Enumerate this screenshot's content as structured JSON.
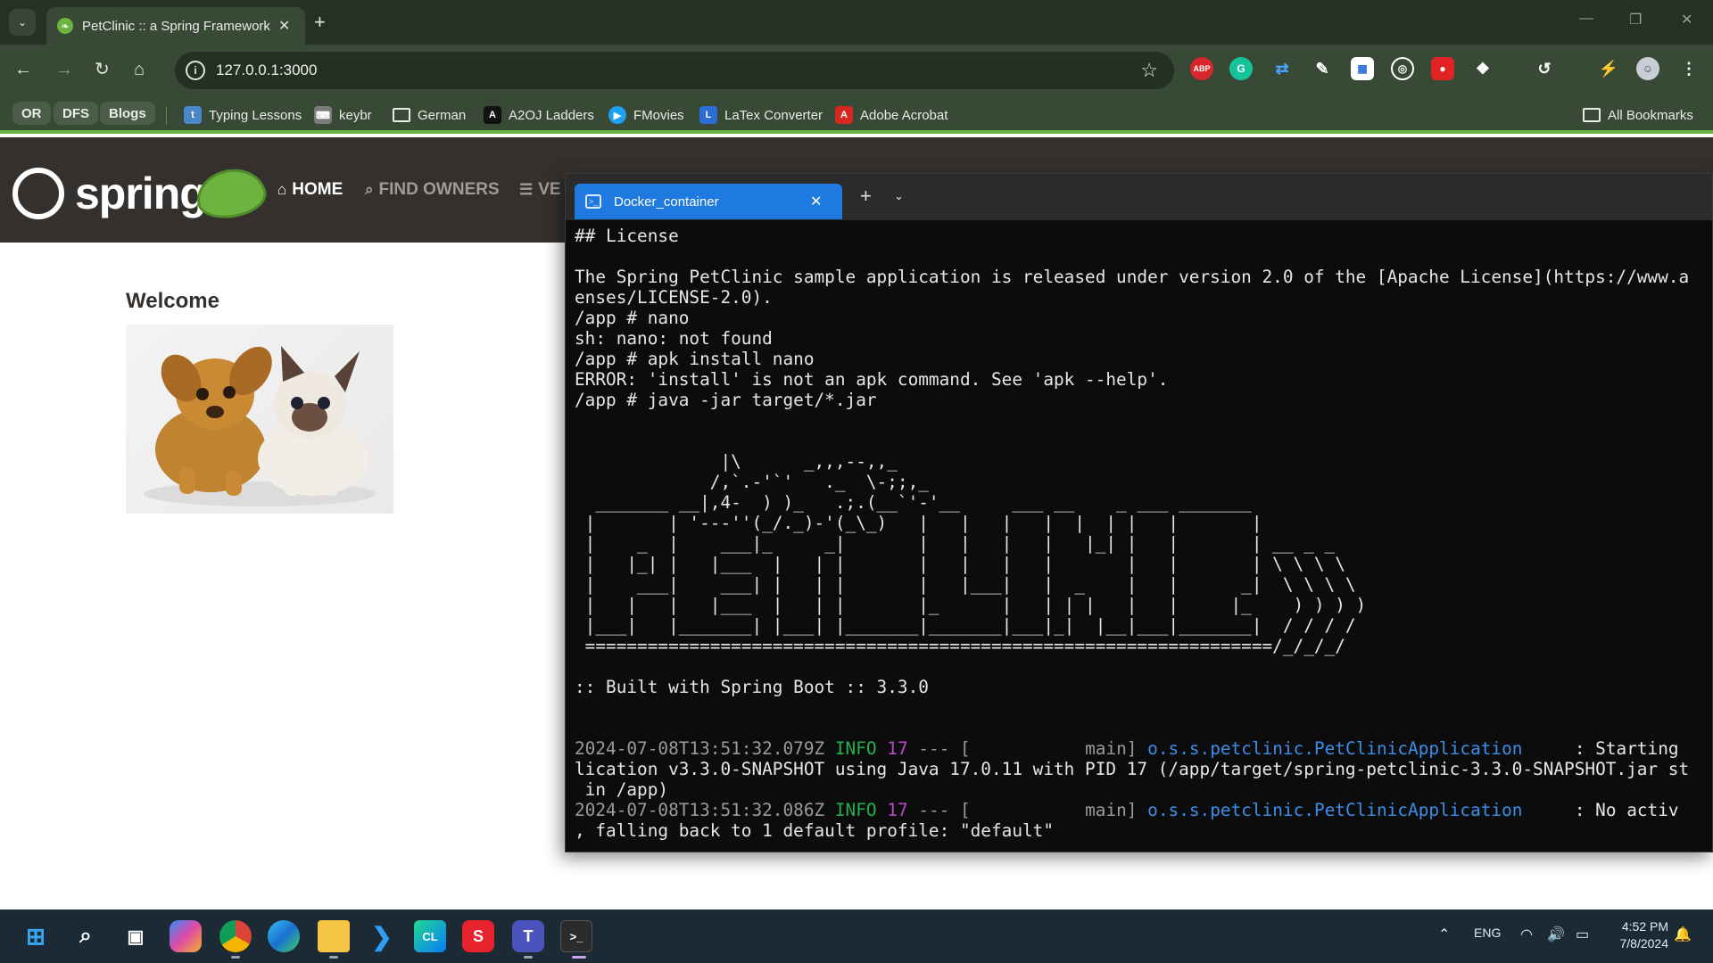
{
  "browser": {
    "tab": {
      "title": "PetClinic :: a Spring Framework"
    },
    "omnibox": {
      "url": "127.0.0.1:3000"
    },
    "extensions": [
      "abp-icon",
      "grammarly-icon",
      "sync-icon",
      "eyedropper-icon",
      "tab-resize-icon",
      "chatgpt-icon",
      "screen-recorder-icon",
      "extensions-puzzle-icon",
      "history-icon",
      "performance-icon",
      "profile-avatar",
      "menu-icon"
    ],
    "bookmarks": {
      "pills": [
        "OR",
        "DFS",
        "Blogs"
      ],
      "items": [
        {
          "label": "Typing Lessons",
          "icon": "typing-icon",
          "color": "#4a86c8"
        },
        {
          "label": "keybr",
          "icon": "keyboard-icon",
          "color": "#7b7b7b"
        },
        {
          "label": "German",
          "icon": "folder-icon",
          "color": ""
        },
        {
          "label": "A2OJ Ladders",
          "icon": "a2oj-icon",
          "color": "#111111"
        },
        {
          "label": "FMovies",
          "icon": "play-icon",
          "color": "#1da1f2"
        },
        {
          "label": "LaTex Converter",
          "icon": "latex-icon",
          "color": "#2b6cd6"
        },
        {
          "label": "Adobe Acrobat",
          "icon": "acrobat-icon",
          "color": "#d6281f"
        }
      ],
      "all_bookmarks": "All Bookmarks"
    }
  },
  "site": {
    "logo_text": "spring",
    "nav": [
      {
        "label": "HOME",
        "active": true
      },
      {
        "label": "FIND OWNERS",
        "active": false
      },
      {
        "label": "VE",
        "active": false
      }
    ],
    "welcome": "Welcome"
  },
  "terminal": {
    "tab_title": "Docker_container",
    "lines": [
      "## License",
      "",
      "The Spring PetClinic sample application is released under version 2.0 of the [Apache License](https://www.a",
      "enses/LICENSE-2.0).",
      "/app # nano",
      "sh: nano: not found",
      "/app # apk install nano",
      "ERROR: 'install' is not an apk command. See 'apk --help'.",
      "/app # java -jar target/*.jar",
      "",
      "",
      "              |\\      _,,,--,,_",
      "             /,`.-'`'   ._  \\-;;,_",
      "  _______ __|,4-  ) )_   .;.(__`'-'__     ___ __    _ ___ _______",
      " |       | '---''(_/._)-'(_\\_)   |   |   |   |  |  | |   |       |",
      " |    _  |    ___|_     _|       |   |   |   |   |_| |   |       | __ _ _",
      " |   |_| |   |___  |   | |       |   |   |   |       |   |       | \\ \\ \\ \\",
      " |    ___|    ___| |   | |       |   |___|   |  _    |   |      _|  \\ \\ \\ \\",
      " |   |   |   |___  |   | |       |_      |   | | |   |   |     |_    ) ) ) )",
      " |___|   |_______| |___| |_______|_______|___|_|  |__|___|_______|  / / / /",
      " ==================================================================/_/_/_/",
      "",
      ":: Built with Spring Boot :: 3.3.0",
      "",
      ""
    ],
    "logs": [
      {
        "timestamp": "2024-07-08T13:51:32.079Z",
        "level": "INFO",
        "pid": "17",
        "thread": "--- [           main]",
        "logger": "o.s.s.petclinic.PetClinicApplication",
        "message": "     : Starting",
        "continuation": [
          "lication v3.3.0-SNAPSHOT using Java 17.0.11 with PID 17 (/app/target/spring-petclinic-3.3.0-SNAPSHOT.jar st",
          " in /app)"
        ]
      },
      {
        "timestamp": "2024-07-08T13:51:32.086Z",
        "level": "INFO",
        "pid": "17",
        "thread": "--- [           main]",
        "logger": "o.s.s.petclinic.PetClinicApplication",
        "message": "     : No activ",
        "continuation": [
          ", falling back to 1 default profile: \"default\""
        ]
      }
    ]
  },
  "taskbar": {
    "apps": [
      "start-icon",
      "search-icon",
      "task-view-icon",
      "copilot-icon",
      "chrome-icon",
      "edge-icon",
      "file-explorer-icon",
      "vscode-icon",
      "clion-icon",
      "screenpresso-icon",
      "teams-icon",
      "terminal-icon"
    ],
    "tray": {
      "language": "ENG",
      "time": "4:52 PM",
      "date": "7/8/2024"
    }
  },
  "colors": {
    "spring_green": "#6db33f",
    "nav_bg": "#34302d",
    "terminal_tab": "#1f7ae0",
    "log_info": "#21b04a",
    "log_pid": "#b94ac9",
    "log_logger": "#3b8eea"
  }
}
